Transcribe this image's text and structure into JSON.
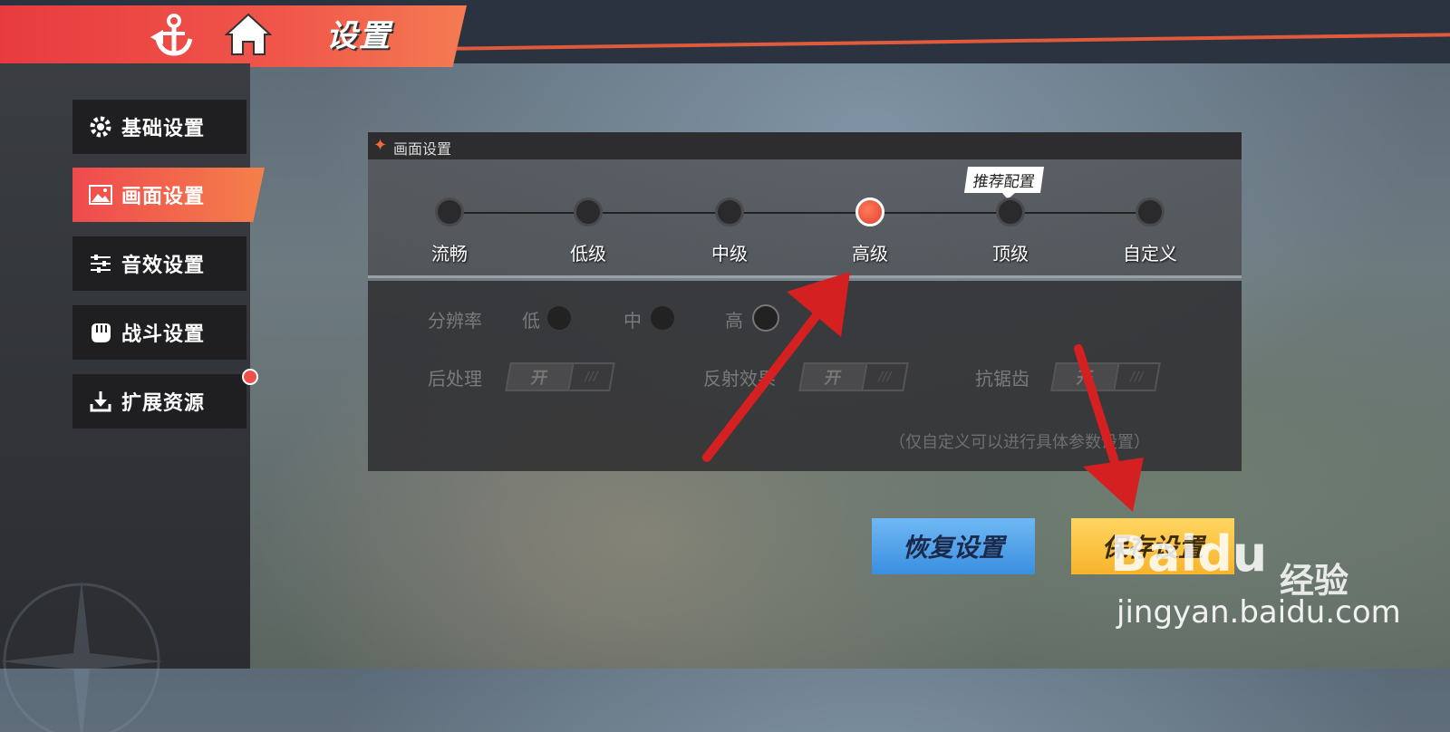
{
  "header": {
    "title": "设置",
    "back_icon": "anchor-back-icon",
    "home_icon": "home-icon"
  },
  "sidebar": {
    "items": [
      {
        "label": "基础设置",
        "icon": "gear-icon",
        "active": false
      },
      {
        "label": "画面设置",
        "icon": "image-icon",
        "active": true
      },
      {
        "label": "音效设置",
        "icon": "sliders-icon",
        "active": false
      },
      {
        "label": "战斗设置",
        "icon": "fist-icon",
        "active": false
      },
      {
        "label": "扩展资源",
        "icon": "download-icon",
        "active": false,
        "notification": true
      }
    ]
  },
  "panel": {
    "title": "画面设置",
    "recommend_tag": "推荐配置",
    "quality_levels": [
      "流畅",
      "低级",
      "中级",
      "高级",
      "顶级",
      "自定义"
    ],
    "selected_quality": "高级",
    "resolution": {
      "label": "分辨率",
      "options": [
        "低",
        "中",
        "高"
      ]
    },
    "toggles": [
      {
        "label": "后处理",
        "on_text": "开",
        "off_text": "///"
      },
      {
        "label": "反射效果",
        "on_text": "开",
        "off_text": "///"
      },
      {
        "label": "抗锯齿",
        "on_text": "开",
        "off_text": "///"
      }
    ],
    "note": "（仅自定义可以进行具体参数设置）"
  },
  "buttons": {
    "restore": "恢复设置",
    "save": "保存设置"
  },
  "watermark": {
    "logo": "Baidu",
    "suffix": "经验",
    "url": "jingyan.baidu.com"
  },
  "colors": {
    "accent_red": "#ef4a4e",
    "restore_blue": "#4a9de6",
    "save_yellow": "#f9c23c",
    "annotation_arrow": "#d42020"
  }
}
